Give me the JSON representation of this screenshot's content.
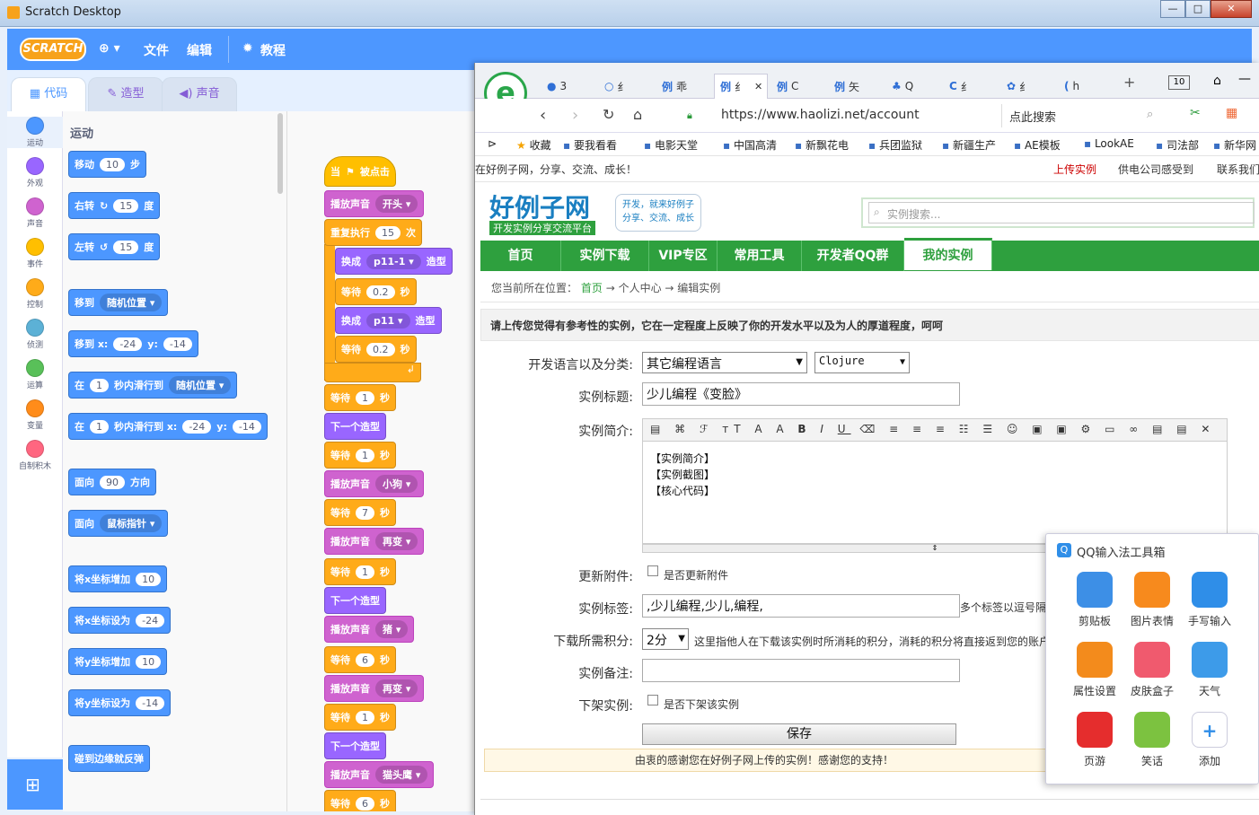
{
  "scratch": {
    "window_title": "Scratch Desktop",
    "logo": "SCRATCH",
    "menu": {
      "file": "文件",
      "edit": "编辑",
      "tutorials": "教程"
    },
    "tabs": {
      "code": "代码",
      "costumes": "造型",
      "sounds": "声音"
    },
    "categories": [
      {
        "label": "运动",
        "color": "#4c97ff"
      },
      {
        "label": "外观",
        "color": "#9966ff"
      },
      {
        "label": "声音",
        "color": "#cf63cf"
      },
      {
        "label": "事件",
        "color": "#ffbf00"
      },
      {
        "label": "控制",
        "color": "#ffab19"
      },
      {
        "label": "侦测",
        "color": "#5cb1d6"
      },
      {
        "label": "运算",
        "color": "#59c059"
      },
      {
        "label": "变量",
        "color": "#ff8c1a"
      },
      {
        "label": "自制积木",
        "color": "#ff6680"
      }
    ],
    "palette_heading": "运动",
    "palette": {
      "move": {
        "a": "移动",
        "n": "10",
        "b": "步"
      },
      "turn_right": {
        "a": "右转",
        "n": "15",
        "b": "度"
      },
      "turn_left": {
        "a": "左转",
        "n": "15",
        "b": "度"
      },
      "goto": {
        "a": "移到",
        "dd": "随机位置"
      },
      "goto_xy": {
        "a": "移到 x:",
        "x": "-24",
        "b": "y:",
        "y": "-14"
      },
      "glide": {
        "a": "在",
        "n": "1",
        "b": "秒内滑行到",
        "dd": "随机位置"
      },
      "glide_xy": {
        "a": "在",
        "n": "1",
        "b": "秒内滑行到 x:",
        "x": "-24",
        "c": "y:",
        "y": "-14"
      },
      "point_dir": {
        "a": "面向",
        "n": "90",
        "b": "方向"
      },
      "point_towards": {
        "a": "面向",
        "dd": "鼠标指针"
      },
      "change_x": {
        "a": "将x坐标增加",
        "n": "10"
      },
      "set_x": {
        "a": "将x坐标设为",
        "n": "-24"
      },
      "change_y": {
        "a": "将y坐标增加",
        "n": "10"
      },
      "set_y": {
        "a": "将y坐标设为",
        "n": "-14"
      },
      "bounce": {
        "a": "碰到边缘就反弹"
      }
    },
    "script": {
      "hat": {
        "a": "当",
        "b": "被点击"
      },
      "play1": {
        "a": "播放声音",
        "dd": "开头"
      },
      "repeat": {
        "a": "重复执行",
        "n": "15",
        "b": "次"
      },
      "sw1": {
        "a": "换成",
        "dd": "p11-1",
        "b": "造型"
      },
      "wait1": {
        "a": "等待",
        "n": "0.2",
        "b": "秒"
      },
      "sw2": {
        "a": "换成",
        "dd": "p11",
        "b": "造型"
      },
      "wait2": {
        "a": "等待",
        "n": "0.2",
        "b": "秒"
      },
      "wait3": {
        "a": "等待",
        "n": "1",
        "b": "秒"
      },
      "next1": {
        "a": "下一个造型"
      },
      "wait4": {
        "a": "等待",
        "n": "1",
        "b": "秒"
      },
      "play2": {
        "a": "播放声音",
        "dd": "小狗"
      },
      "wait5": {
        "a": "等待",
        "n": "7",
        "b": "秒"
      },
      "play3": {
        "a": "播放声音",
        "dd": "再变"
      },
      "wait6": {
        "a": "等待",
        "n": "1",
        "b": "秒"
      },
      "next2": {
        "a": "下一个造型"
      },
      "play4": {
        "a": "播放声音",
        "dd": "猪"
      },
      "wait7": {
        "a": "等待",
        "n": "6",
        "b": "秒"
      },
      "play5": {
        "a": "播放声音",
        "dd": "再变"
      },
      "wait8": {
        "a": "等待",
        "n": "1",
        "b": "秒"
      },
      "next3": {
        "a": "下一个造型"
      },
      "play6": {
        "a": "播放声音",
        "dd": "猫头鹰"
      },
      "wait9": {
        "a": "等待",
        "n": "6",
        "b": "秒"
      }
    }
  },
  "browser": {
    "tabs": [
      {
        "icon": "●",
        "label": "3"
      },
      {
        "icon": "○",
        "label": "纟"
      },
      {
        "icon": "例",
        "label": "乖"
      },
      {
        "icon": "例",
        "label": "纟"
      },
      {
        "icon": "例",
        "label": "C"
      },
      {
        "icon": "例",
        "label": "矢"
      },
      {
        "icon": "♣",
        "label": "Q"
      },
      {
        "icon": "C",
        "label": "纟"
      },
      {
        "icon": "✿",
        "label": "纟"
      },
      {
        "icon": "(",
        "label": "h"
      }
    ],
    "tab_count": "10",
    "url": "https://www.haolizi.net/account",
    "search_placeholder": "点此搜索",
    "bookmarks": [
      "收藏",
      "要我看看",
      "电影天堂",
      "中国高清",
      "新飘花电",
      "兵团监狱",
      "新疆生产",
      "AE模板",
      "LookAE",
      "司法部",
      "新华网"
    ],
    "page": {
      "slogan": "在好例子网，分享、交流、成长！",
      "top_links": [
        "上传实例",
        "供电公司感受到",
        "联系我们"
      ],
      "site_name": "好例子网",
      "site_sub": "开发实例分享交流平台",
      "bubble1": "开发，就来好例子",
      "bubble2": "分享、交流、成长",
      "search_placeholder": "实例搜索...",
      "nav": [
        "首页",
        "实例下载",
        "VIP专区",
        "常用工具",
        "开发者QQ群",
        "我的实例"
      ],
      "crumb_prefix": "您当前所在位置：",
      "crumbs": [
        "首页",
        "个人中心",
        "编辑实例"
      ],
      "notice": "请上传您觉得有参考性的实例，它在一定程度上反映了你的开发水平以及为人的厚道程度，呵呵",
      "form": {
        "lang_label": "开发语言以及分类:",
        "lang_value": "其它编程语言",
        "cat_value": "Clojure",
        "title_label": "实例标题:",
        "title_value": "少儿编程《变脸》",
        "intro_label": "实例简介:",
        "intro_lines": [
          "【实例简介】",
          "【实例截图】",
          "【核心代码】"
        ],
        "attach_label": "更新附件:",
        "attach_check": "是否更新附件",
        "tags_label": "实例标签:",
        "tags_value": ",少儿编程,少儿,编程,",
        "tags_hint": "多个标签以逗号隔",
        "points_label": "下载所需积分:",
        "points_value": "2分",
        "points_hint": "这里指他人在下载该实例时所消耗的积分，消耗的积分将直接返到您的账户",
        "remark_label": "实例备注:",
        "remark_value": "",
        "offline_label": "下架实例:",
        "offline_check": "是否下架该实例",
        "save": "保存",
        "thanks": "由衷的感谢您在好例子网上传的实例！感谢您的支持！"
      }
    }
  },
  "qq_toolbox": {
    "title": "QQ输入法工具箱",
    "items": [
      {
        "label": "剪贴板",
        "color": "#3d8fe6"
      },
      {
        "label": "图片表情",
        "color": "#f78a1d"
      },
      {
        "label": "手写输入",
        "color": "#2f8ee8"
      },
      {
        "label": "属性设置",
        "color": "#f38b1c"
      },
      {
        "label": "皮肤盒子",
        "color": "#f05a6e"
      },
      {
        "label": "天气",
        "color": "#3d9be9"
      },
      {
        "label": "页游",
        "color": "#e52d2d"
      },
      {
        "label": "笑话",
        "color": "#7cc240"
      },
      {
        "label": "添加",
        "color": "#ffffff"
      }
    ]
  }
}
